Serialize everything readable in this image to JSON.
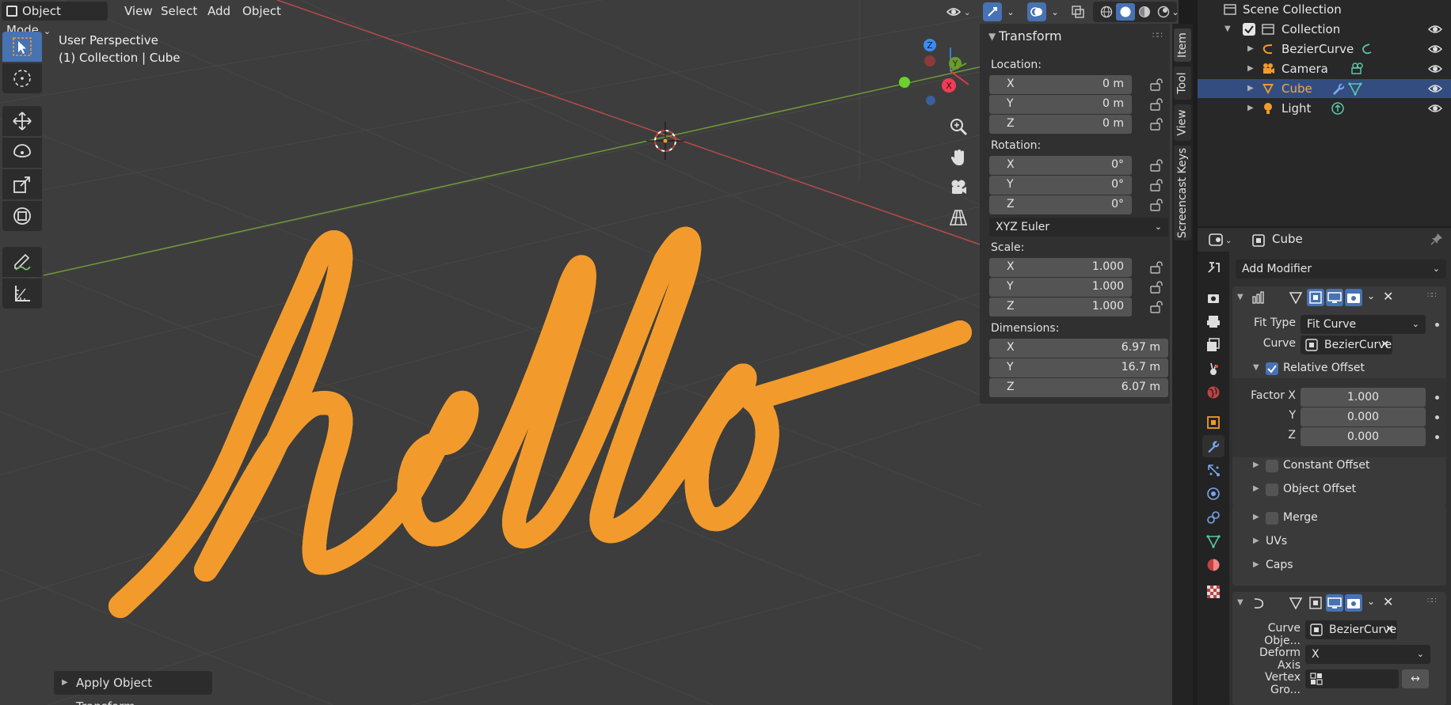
{
  "viewport": {
    "mode": "Object Mode",
    "menu": [
      "View",
      "Select",
      "Add",
      "Object"
    ],
    "perspective_label": "User Perspective",
    "context_label": "(1) Collection | Cube",
    "operator_panel": "Apply Object Transform",
    "gizmo_axes": {
      "x": "X",
      "y": "Y",
      "z": "Z"
    }
  },
  "npanel": {
    "title": "Transform",
    "location_label": "Location:",
    "location": [
      {
        "axis": "X",
        "value": "0 m"
      },
      {
        "axis": "Y",
        "value": "0 m"
      },
      {
        "axis": "Z",
        "value": "0 m"
      }
    ],
    "rotation_label": "Rotation:",
    "rotation": [
      {
        "axis": "X",
        "value": "0°"
      },
      {
        "axis": "Y",
        "value": "0°"
      },
      {
        "axis": "Z",
        "value": "0°"
      }
    ],
    "rotation_mode": "XYZ Euler",
    "scale_label": "Scale:",
    "scale": [
      {
        "axis": "X",
        "value": "1.000"
      },
      {
        "axis": "Y",
        "value": "1.000"
      },
      {
        "axis": "Z",
        "value": "1.000"
      }
    ],
    "dimensions_label": "Dimensions:",
    "dimensions": [
      {
        "axis": "X",
        "value": "6.97 m"
      },
      {
        "axis": "Y",
        "value": "16.7 m"
      },
      {
        "axis": "Z",
        "value": "6.07 m"
      }
    ]
  },
  "vtabs": [
    "Item",
    "Tool",
    "View",
    "Screencast Keys"
  ],
  "outliner": {
    "root": "Scene Collection",
    "collection": "Collection",
    "items": [
      {
        "name": "BezierCurve",
        "selected": false
      },
      {
        "name": "Camera",
        "selected": false
      },
      {
        "name": "Cube",
        "selected": true
      },
      {
        "name": "Light",
        "selected": false
      }
    ]
  },
  "properties": {
    "object_name": "Cube",
    "add_modifier": "Add Modifier",
    "array": {
      "fit_type_label": "Fit Type",
      "fit_type": "Fit Curve",
      "curve_label": "Curve",
      "curve": "BezierCurve",
      "relative_offset_label": "Relative Offset",
      "factor_x_label": "Factor X",
      "factor_x": "1.000",
      "y_label": "Y",
      "factor_y": "0.000",
      "z_label": "Z",
      "factor_z": "0.000",
      "constant_offset": "Constant Offset",
      "object_offset": "Object Offset",
      "merge": "Merge",
      "uvs": "UVs",
      "caps": "Caps"
    },
    "curve_mod": {
      "curve_object_label": "Curve Obje...",
      "curve_object": "BezierCurve",
      "deform_axis_label": "Deform Axis",
      "deform_axis": "X",
      "vertex_group_label": "Vertex Gro..."
    }
  },
  "colors": {
    "viewport_bg": "#3d3d3d",
    "selection_outline": "#f29b2c",
    "accent": "#4772b3",
    "x_axis": "#c94a4a",
    "y_axis": "#74a33a"
  }
}
